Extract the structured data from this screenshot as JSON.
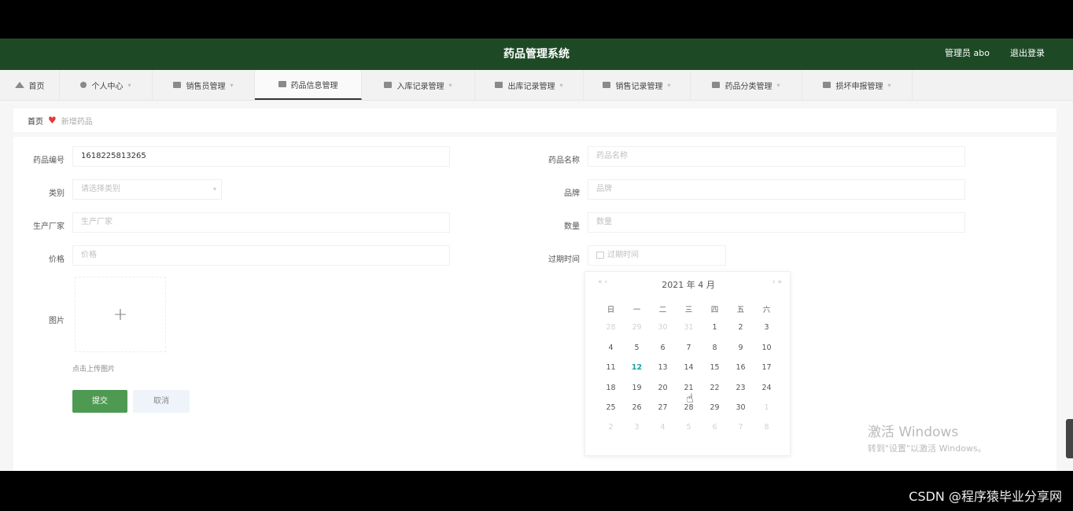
{
  "header": {
    "title": "药品管理系统",
    "user": "管理员 abo",
    "logout": "退出登录"
  },
  "nav": [
    {
      "label": "首页",
      "icon": "home-icon"
    },
    {
      "label": "个人中心",
      "icon": "person-icon",
      "dropdown": true
    },
    {
      "label": "销售员管理",
      "icon": "monitor-icon",
      "dropdown": true
    },
    {
      "label": "药品信息管理",
      "icon": "document-icon",
      "dropdown": true,
      "active": true
    },
    {
      "label": "入库记录管理",
      "icon": "group-icon",
      "dropdown": true
    },
    {
      "label": "出库记录管理",
      "icon": "truck-icon",
      "dropdown": true
    },
    {
      "label": "销售记录管理",
      "icon": "table-icon",
      "dropdown": true
    },
    {
      "label": "药品分类管理",
      "icon": "sort-icon",
      "dropdown": true
    },
    {
      "label": "损坏申报管理",
      "icon": "report-icon",
      "dropdown": true
    }
  ],
  "breadcrumb": {
    "home": "首页",
    "separator_icon": "heart-icon",
    "current": "新增药品"
  },
  "form": {
    "code_label": "药品编号",
    "code_value": "1618225813265",
    "name_label": "药品名称",
    "name_placeholder": "药品名称",
    "category_label": "类别",
    "category_placeholder": "请选择类别",
    "brand_label": "品牌",
    "brand_placeholder": "品牌",
    "maker_label": "生产厂家",
    "maker_placeholder": "生产厂家",
    "qty_label": "数量",
    "qty_placeholder": "数量",
    "price_label": "价格",
    "price_placeholder": "价格",
    "expiry_label": "过期时间",
    "expiry_placeholder": "过期时间",
    "image_label": "图片",
    "upload_plus": "+",
    "upload_hint": "点击上传图片",
    "submit": "提交",
    "cancel": "取消"
  },
  "calendar": {
    "prev": "« ‹",
    "next": "› »",
    "year": "2021",
    "year_unit": "年",
    "month": "4",
    "month_unit": "月",
    "weekdays": [
      "日",
      "一",
      "二",
      "三",
      "四",
      "五",
      "六"
    ],
    "rows": [
      [
        "28",
        "29",
        "30",
        "31",
        "1",
        "2",
        "3"
      ],
      [
        "4",
        "5",
        "6",
        "7",
        "8",
        "9",
        "10"
      ],
      [
        "11",
        "12",
        "13",
        "14",
        "15",
        "16",
        "17"
      ],
      [
        "18",
        "19",
        "20",
        "21",
        "22",
        "23",
        "24"
      ],
      [
        "25",
        "26",
        "27",
        "28",
        "29",
        "30",
        "1"
      ],
      [
        "2",
        "3",
        "4",
        "5",
        "6",
        "7",
        "8"
      ]
    ],
    "today": "12"
  },
  "watermark": {
    "line1": "激活 Windows",
    "line2": "转到\"设置\"以激活 Windows。"
  },
  "csdn": "CSDN @程序猿毕业分享网"
}
